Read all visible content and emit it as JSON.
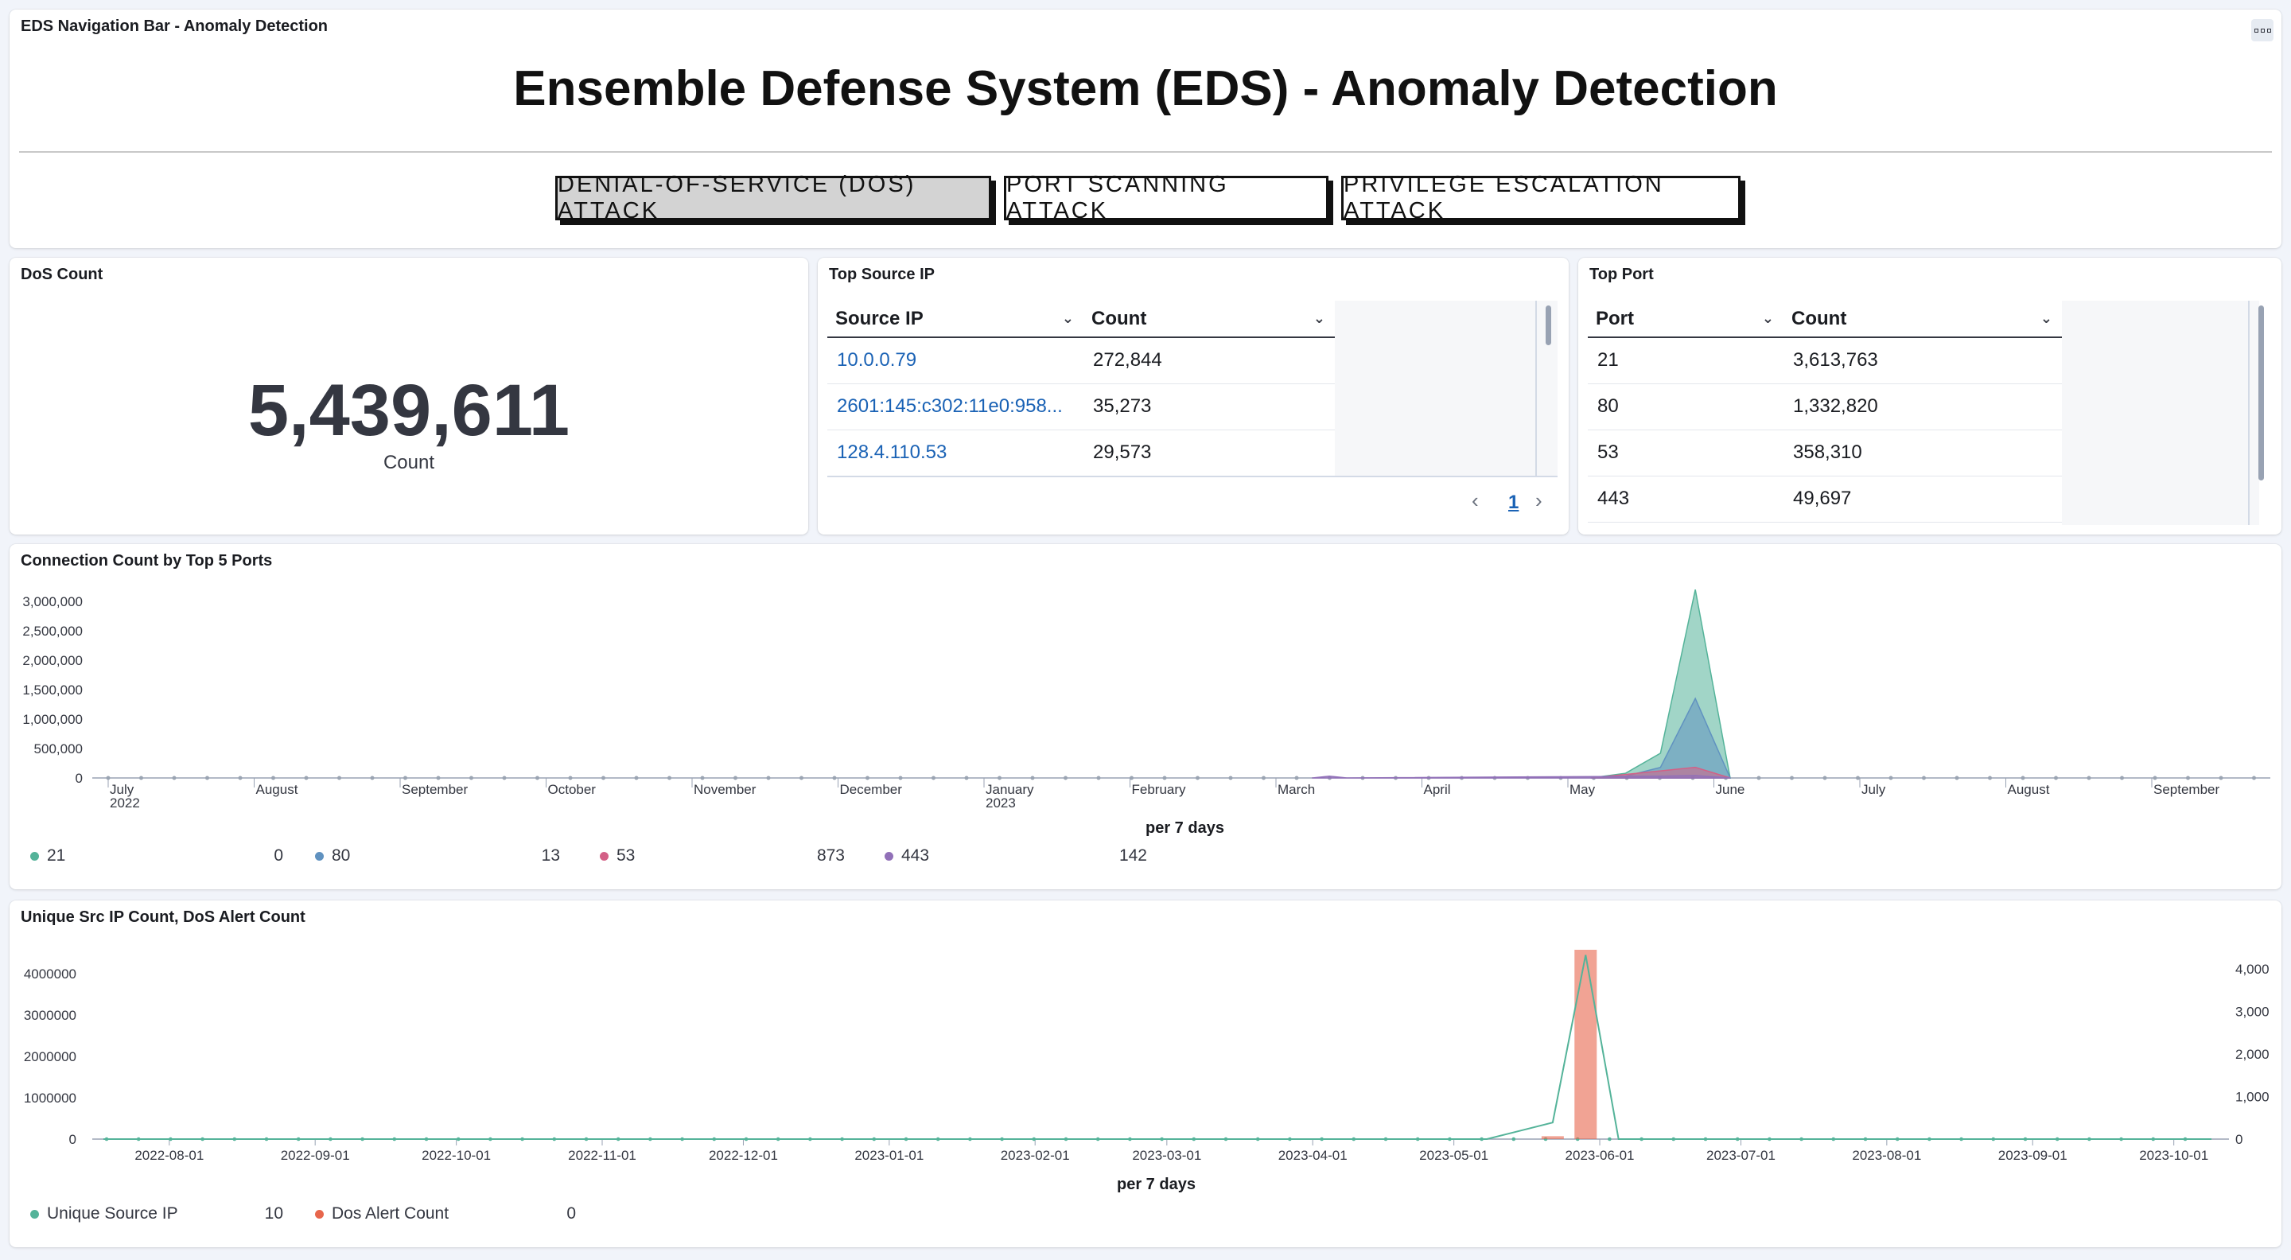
{
  "nav_panel": {
    "title": "EDS Navigation Bar - Anomaly Detection",
    "heading": "Ensemble Defense System (EDS) - Anomaly Detection",
    "buttons": [
      {
        "label": "DENIAL-OF-SERVICE (DOS) ATTACK",
        "active": true
      },
      {
        "label": "PORT SCANNING ATTACK",
        "active": false
      },
      {
        "label": "PRIVILEGE ESCALATION ATTACK",
        "active": false
      }
    ],
    "menu_icon": "options-icon"
  },
  "dos_count": {
    "title": "DoS Count",
    "value": "5,439,611",
    "label": "Count"
  },
  "top_source_ip": {
    "title": "Top Source IP",
    "columns": [
      "Source IP",
      "Count"
    ],
    "rows": [
      {
        "ip": "10.0.0.79",
        "count": "272,844"
      },
      {
        "ip": "2601:145:c302:11e0:958...",
        "count": "35,273"
      },
      {
        "ip": "128.4.110.53",
        "count": "29,573"
      }
    ],
    "page": "1"
  },
  "top_port": {
    "title": "Top Port",
    "columns": [
      "Port",
      "Count"
    ],
    "rows": [
      {
        "port": "21",
        "count": "3,613,763"
      },
      {
        "port": "80",
        "count": "1,332,820"
      },
      {
        "port": "53",
        "count": "358,310"
      },
      {
        "port": "443",
        "count": "49,697"
      }
    ]
  },
  "connection_chart": {
    "title": "Connection Count by Top 5 Ports",
    "xlabel": "per 7 days",
    "legend": [
      {
        "name": "21",
        "value": "0",
        "color": "#54b399"
      },
      {
        "name": "80",
        "value": "13",
        "color": "#6092c0"
      },
      {
        "name": "53",
        "value": "873",
        "color": "#d36086"
      },
      {
        "name": "443",
        "value": "142",
        "color": "#9170b8"
      }
    ]
  },
  "unique_chart": {
    "title": "Unique Src IP Count, DoS Alert Count",
    "xlabel": "per 7 days",
    "legend": [
      {
        "name": "Unique Source IP",
        "value": "10",
        "color": "#54b399"
      },
      {
        "name": "Dos Alert Count",
        "value": "0",
        "color": "#e7664c"
      }
    ]
  },
  "chart_data": [
    {
      "type": "area",
      "title": "Connection Count by Top 5 Ports",
      "xlabel": "per 7 days",
      "ylabel": "",
      "ylim": [
        0,
        3000000
      ],
      "yticks": [
        "3,000,000",
        "2,500,000",
        "2,000,000",
        "1,500,000",
        "1,000,000",
        "500,000",
        "0"
      ],
      "xticks": [
        {
          "label": "July",
          "sub": "2022"
        },
        {
          "label": "August",
          "sub": ""
        },
        {
          "label": "September",
          "sub": ""
        },
        {
          "label": "October",
          "sub": ""
        },
        {
          "label": "November",
          "sub": ""
        },
        {
          "label": "December",
          "sub": ""
        },
        {
          "label": "January",
          "sub": "2023"
        },
        {
          "label": "February",
          "sub": ""
        },
        {
          "label": "March",
          "sub": ""
        },
        {
          "label": "April",
          "sub": ""
        },
        {
          "label": "May",
          "sub": ""
        },
        {
          "label": "June",
          "sub": ""
        },
        {
          "label": "July",
          "sub": ""
        },
        {
          "label": "August",
          "sub": ""
        },
        {
          "label": "September",
          "sub": ""
        }
      ],
      "series": [
        {
          "name": "21",
          "color": "#54b399",
          "values": [
            [
              2023.36,
              0
            ],
            [
              2023.38,
              80000
            ],
            [
              2023.4,
              420000
            ],
            [
              2023.42,
              3200000
            ],
            [
              2023.44,
              0
            ]
          ]
        },
        {
          "name": "80",
          "color": "#6092c0",
          "values": [
            [
              2023.36,
              0
            ],
            [
              2023.38,
              30000
            ],
            [
              2023.4,
              180000
            ],
            [
              2023.42,
              1350000
            ],
            [
              2023.44,
              0
            ]
          ]
        },
        {
          "name": "53",
          "color": "#d36086",
          "values": [
            [
              2023.36,
              0
            ],
            [
              2023.4,
              120000
            ],
            [
              2023.42,
              180000
            ],
            [
              2023.44,
              0
            ]
          ]
        },
        {
          "name": "443",
          "color": "#9170b8",
          "values": [
            [
              2023.2,
              0
            ],
            [
              2023.21,
              30000
            ],
            [
              2023.22,
              0
            ],
            [
              2023.4,
              30000
            ],
            [
              2023.42,
              40000
            ],
            [
              2023.44,
              0
            ]
          ]
        }
      ]
    },
    {
      "type": "bar",
      "title": "Unique Src IP Count, DoS Alert Count",
      "xlabel": "per 7 days",
      "ylim_left": [
        0,
        4000000
      ],
      "ylim_right": [
        0,
        4000
      ],
      "yticks_left": [
        "4000000",
        "3000000",
        "2000000",
        "1000000",
        "0"
      ],
      "yticks_right": [
        "4,000",
        "3,000",
        "2,000",
        "1,000",
        "0"
      ],
      "xticks": [
        "2022-08-01",
        "2022-09-01",
        "2022-10-01",
        "2022-11-01",
        "2022-12-01",
        "2023-01-01",
        "2023-02-01",
        "2023-03-01",
        "2023-04-01",
        "2023-05-01",
        "2023-06-01",
        "2023-07-01",
        "2023-08-01",
        "2023-09-01",
        "2023-10-01"
      ],
      "series": [
        {
          "name": "Dos Alert Count",
          "color": "#e7664c",
          "axis": "left",
          "bars": [
            [
              "2023-05-22",
              70000
            ],
            [
              "2023-05-29",
              4700000
            ]
          ]
        },
        {
          "name": "Unique Source IP",
          "color": "#54b399",
          "axis": "right",
          "values": [
            [
              "2022-07-18",
              0
            ],
            [
              "2023-05-08",
              0
            ],
            [
              "2023-05-22",
              400
            ],
            [
              "2023-05-29",
              4450
            ],
            [
              "2023-06-05",
              0
            ],
            [
              "2023-10-09",
              0
            ]
          ]
        }
      ]
    }
  ]
}
